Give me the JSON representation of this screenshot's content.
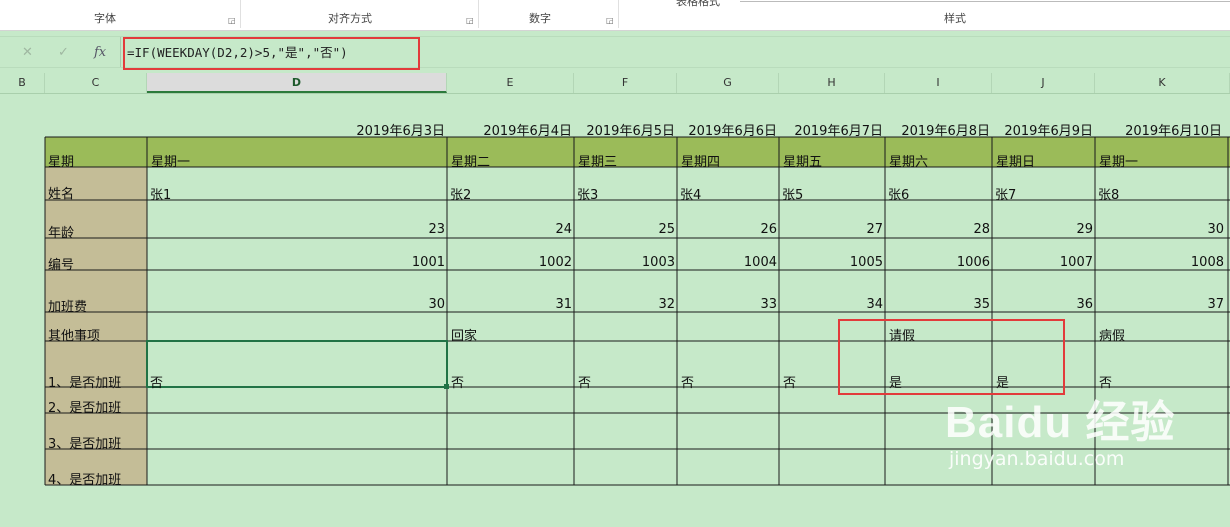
{
  "ribbon": {
    "groups": [
      "字体",
      "对齐方式",
      "数字",
      "样式"
    ],
    "cut_label": "表格格式"
  },
  "formula_bar": {
    "cancel_icon": "✕",
    "confirm_icon": "✓",
    "fx_label": "fx",
    "formula": "=IF(WEEKDAY(D2,2)>5,\"是\",\"否\")"
  },
  "columns": [
    "B",
    "C",
    "D",
    "E",
    "F",
    "G",
    "H",
    "I",
    "J",
    "K"
  ],
  "active_column": "D",
  "sheet": {
    "dates": [
      "2019年6月3日",
      "2019年6月4日",
      "2019年6月5日",
      "2019年6月6日",
      "2019年6月7日",
      "2019年6月8日",
      "2019年6月9日",
      "2019年6月10日"
    ],
    "row_labels": [
      "星期",
      "姓名",
      "年龄",
      "编号",
      "加班费",
      "其他事项",
      "1、是否加班",
      "2、是否加班",
      "3、是否加班",
      "4、是否加班"
    ],
    "weekday": [
      "星期一",
      "星期二",
      "星期三",
      "星期四",
      "星期五",
      "星期六",
      "星期日",
      "星期一"
    ],
    "name": [
      "张1",
      "张2",
      "张3",
      "张4",
      "张5",
      "张6",
      "张7",
      "张8"
    ],
    "age": [
      "23",
      "24",
      "25",
      "26",
      "27",
      "28",
      "29",
      "30"
    ],
    "id": [
      "1001",
      "1002",
      "1003",
      "1004",
      "1005",
      "1006",
      "1007",
      "1008"
    ],
    "overtime_pay": [
      "30",
      "31",
      "32",
      "33",
      "34",
      "35",
      "36",
      "37"
    ],
    "other": [
      "",
      "回家",
      "",
      "",
      "",
      "请假",
      "",
      "病假"
    ],
    "is_overtime_1": [
      "否",
      "否",
      "否",
      "否",
      "否",
      "是",
      "是",
      "否"
    ]
  },
  "watermark": {
    "brand": "Baidu 经验",
    "url": "jingyan.baidu.com"
  },
  "colors": {
    "grid_bg": "#c6e9c9",
    "header_band": "#9bbb59",
    "label_column": "#c4bd97",
    "highlight": "#e23b3b"
  }
}
